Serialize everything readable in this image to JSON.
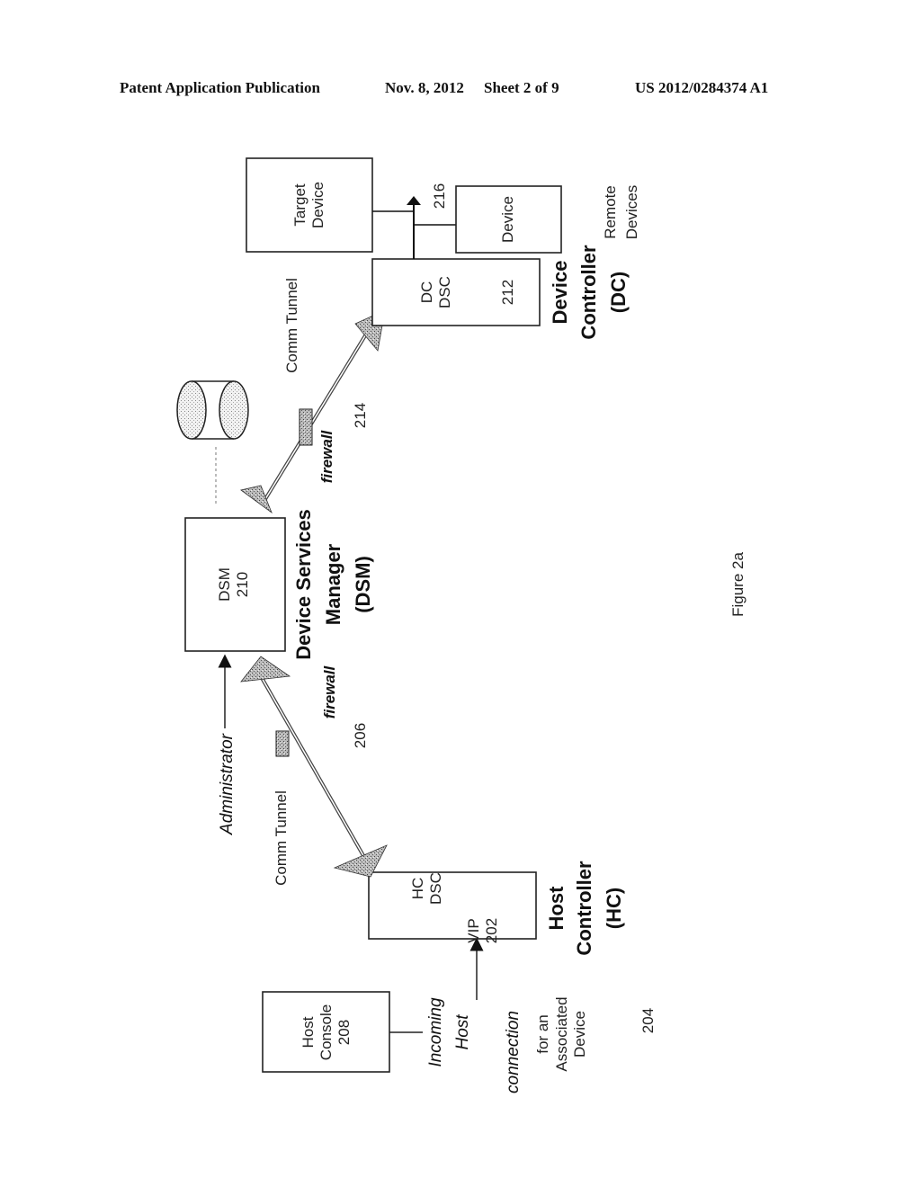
{
  "header": {
    "publication": "Patent Application Publication",
    "date": "Nov. 8, 2012",
    "sheet": "Sheet 2 of 9",
    "number": "US 2012/0284374 A1"
  },
  "figure": {
    "caption": "Figure 2a",
    "nodes": {
      "host_console": {
        "line1": "Host",
        "line2": "Console",
        "line3": "208"
      },
      "host_controller_box": {
        "line1": "HC",
        "line2": "DSC",
        "line3": "VIP",
        "line4": "202"
      },
      "host_controller_title": {
        "line1": "Host",
        "line2": "Controller",
        "line3": "(HC)"
      },
      "dsm_box": {
        "line1": "DSM",
        "line2": "210"
      },
      "dsm_title": {
        "line1": "Device Services",
        "line2": "Manager",
        "line3": "(DSM)"
      },
      "dc_box": {
        "line1": "DC",
        "line2": "DSC",
        "line3": "212"
      },
      "dc_title": {
        "line1": "Device",
        "line2": "Controller",
        "line3": "(DC)"
      },
      "target_device": {
        "line1": "Target",
        "line2": "Device"
      },
      "device": {
        "line1": "Device"
      },
      "remote_devices": {
        "line1": "Remote",
        "line2": "Devices"
      }
    },
    "labels": {
      "incoming": {
        "line1": "Incoming",
        "line2": "Host",
        "line3": "connection",
        "line4": "for an",
        "line5": "Associated",
        "line6": "Device",
        "ref": "204"
      },
      "administrator": "Administrator",
      "comm_tunnel_left": "Comm Tunnel",
      "comm_tunnel_right": "Comm Tunnel",
      "firewall_left": "firewall",
      "firewall_left_ref": "206",
      "firewall_right": "firewall",
      "firewall_right_ref": "214",
      "device_link_ref": "216"
    }
  }
}
